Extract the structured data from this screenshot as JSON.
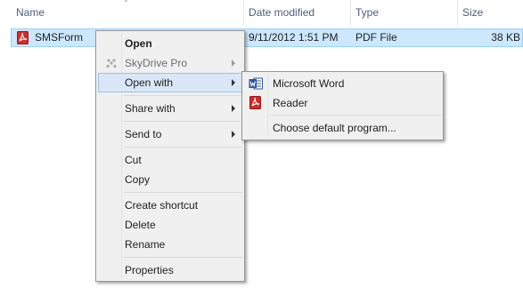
{
  "columns": {
    "name": "Name",
    "date_modified": "Date modified",
    "type": "Type",
    "size": "Size"
  },
  "file": {
    "name": "SMSForm",
    "date_modified": "9/11/2012 1:51 PM",
    "type": "PDF File",
    "size": "38 KB"
  },
  "context_menu": {
    "open": "Open",
    "skydrive_pro": "SkyDrive Pro",
    "open_with": "Open with",
    "share_with": "Share with",
    "send_to": "Send to",
    "cut": "Cut",
    "copy": "Copy",
    "create_shortcut": "Create shortcut",
    "delete": "Delete",
    "rename": "Rename",
    "properties": "Properties"
  },
  "open_with_menu": {
    "word": "Microsoft Word",
    "reader": "Reader",
    "choose_default": "Choose default program..."
  },
  "colors": {
    "selection_bg": "#cce8ff",
    "selection_border": "#99d1ff",
    "menu_bg": "#f0f0f0",
    "menu_highlight": "#d9e7f7",
    "header_text": "#4c607a",
    "pdf_red": "#c8211f",
    "word_blue": "#2b579a"
  },
  "icons": [
    "sort-up-icon",
    "pdf-file-icon",
    "skydrive-pro-icon",
    "submenu-arrow-icon",
    "microsoft-word-icon",
    "reader-icon"
  ]
}
